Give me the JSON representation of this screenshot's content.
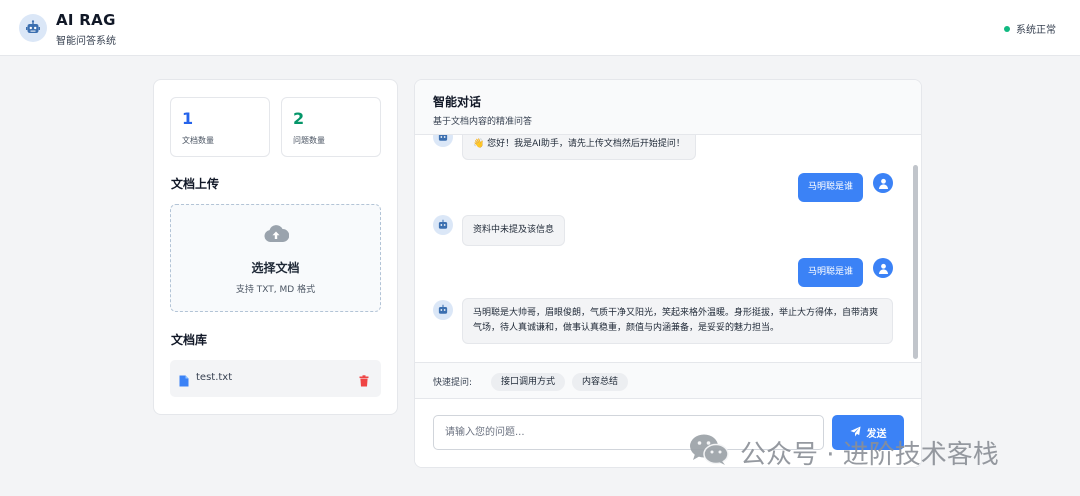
{
  "header": {
    "title": "AI RAG",
    "subtitle": "智能问答系统",
    "status_text": "系统正常",
    "status_color": "#10b981"
  },
  "stats": [
    {
      "value": "1",
      "label": "文档数量"
    },
    {
      "value": "2",
      "label": "问题数量"
    }
  ],
  "upload": {
    "section_title": "文档上传",
    "title": "选择文档",
    "hint": "支持 TXT, MD 格式",
    "icon": "cloud-upload-icon"
  },
  "library": {
    "section_title": "文档库",
    "documents": [
      {
        "name": "test.txt",
        "icon": "file-icon",
        "action_icon": "trash-icon"
      }
    ]
  },
  "chat": {
    "title": "智能对话",
    "subtitle": "基于文档内容的精准问答",
    "messages": [
      {
        "role": "bot",
        "text": "👋 您好！我是AI助手，请先上传文档然后开始提问！"
      },
      {
        "role": "user",
        "text": "马明聪是谁"
      },
      {
        "role": "bot",
        "text": "资料中未提及该信息"
      },
      {
        "role": "user",
        "text": "马明聪是谁"
      },
      {
        "role": "bot",
        "text": "马明聪是大帅哥，眉眼俊朗，气质干净又阳光，笑起来格外温暖。身形挺拔，举止大方得体，自带清爽气场，待人真诚谦和，做事认真稳重，颜值与内涵兼备，是妥妥的魅力担当。"
      }
    ],
    "quick_label": "快速提问:",
    "quick_questions": [
      "接口调用方式",
      "内容总结"
    ],
    "input_placeholder": "请输入您的问题...",
    "send_label": "发送"
  },
  "watermark": {
    "text": "公众号 · 进阶技术客栈"
  },
  "colors": {
    "accent": "#3b82f6",
    "stat_blue": "#2563eb",
    "stat_green": "#059669",
    "danger": "#ef4444"
  }
}
